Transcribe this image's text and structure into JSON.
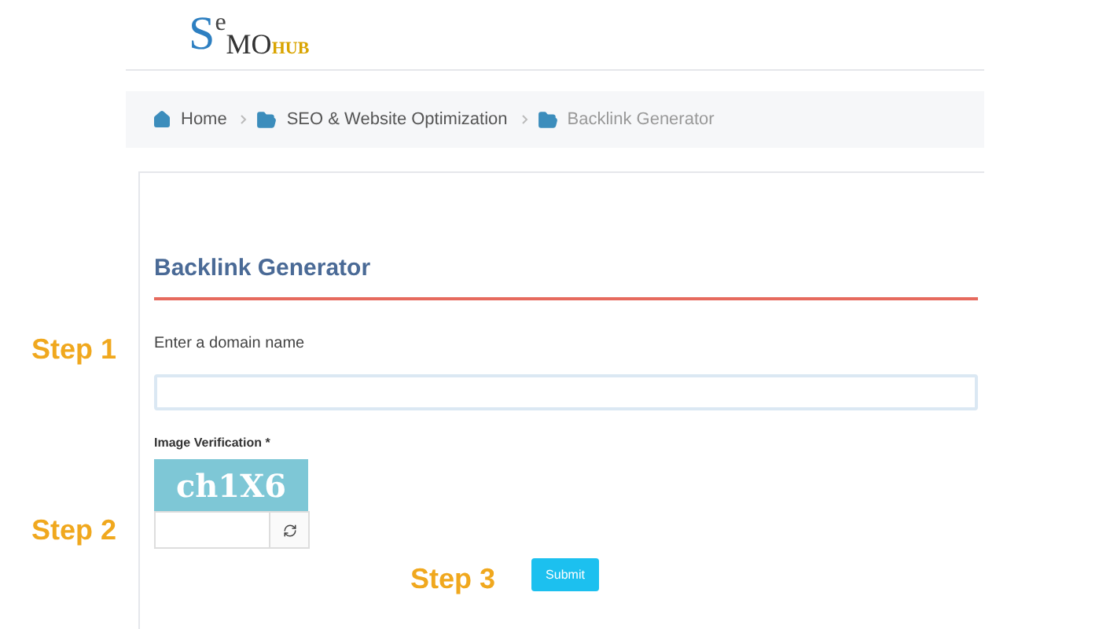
{
  "logo": {
    "first": "S",
    "raised": "e",
    "middle": "MO",
    "suffix": "HUB"
  },
  "breadcrumb": [
    {
      "label": "Home",
      "kind": "home",
      "current": false
    },
    {
      "label": "SEO & Website Optimization",
      "kind": "folder",
      "current": false
    },
    {
      "label": "Backlink Generator",
      "kind": "folder",
      "current": true
    }
  ],
  "form": {
    "title": "Backlink Generator",
    "domain_label": "Enter a domain name",
    "verification_label": "Image Verification *",
    "captcha": "ch1X6",
    "submit": "Submit"
  },
  "steps": [
    {
      "label": "Step 1"
    },
    {
      "label": "Step 2"
    },
    {
      "label": "Step 3"
    }
  ]
}
